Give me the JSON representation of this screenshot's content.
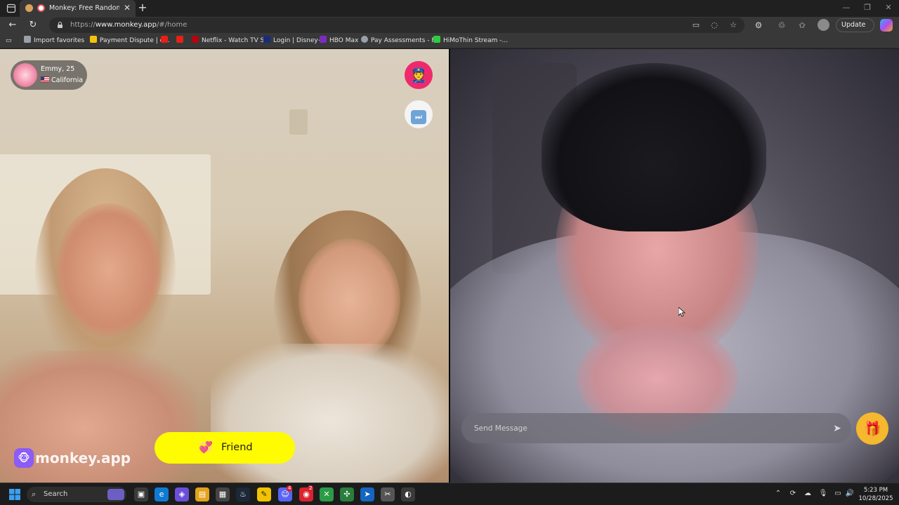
{
  "browser": {
    "tab_title": "Monkey: Free Random Video",
    "url_prefix": "https://",
    "url_host": "www.monkey.app",
    "url_path": "/#/home",
    "update_label": "Update"
  },
  "favorites": [
    {
      "label": "Import favorites",
      "color": "#9aa0a6"
    },
    {
      "label": "Payment Dispute | e...",
      "color": "#f4c20d"
    },
    {
      "label": "",
      "color": "#e62117"
    },
    {
      "label": "",
      "color": "#e62117"
    },
    {
      "label": "Netflix - Watch TV S...",
      "color": "#b1060f"
    },
    {
      "label": "Login | Disney+",
      "color": "#1a2b7a"
    },
    {
      "label": "HBO Max",
      "color": "#7b2cbf"
    },
    {
      "label": "Pay Assessments - F...",
      "color": "#9aa0a6"
    },
    {
      "label": "HiMoThin Stream -...",
      "color": "#2ecc40"
    }
  ],
  "peer": {
    "name_age": "Emmy, 25",
    "location": "California"
  },
  "brand": {
    "logo_text": "monkey.app"
  },
  "actions": {
    "friend_label": "Friend"
  },
  "chat": {
    "placeholder": "Send Message"
  },
  "taskbar": {
    "search_label": "Search",
    "time": "5:23 PM",
    "date": "10/28/2025",
    "badges": [
      "4",
      "2"
    ]
  },
  "colors": {
    "friend_yellow": "#fffb00",
    "report_pink": "#ee2a6c",
    "brand_purple": "#8b5cf6",
    "gift_gold": "#f5b82e"
  }
}
